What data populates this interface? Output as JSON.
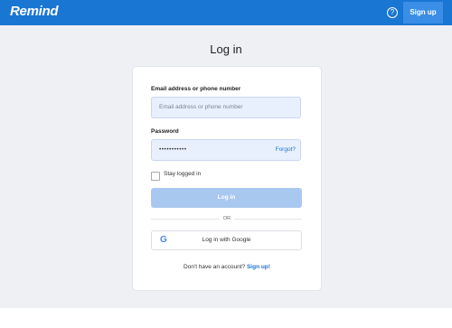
{
  "header": {
    "logo": "Remind",
    "help_icon": "help-circle-icon",
    "signup_label": "Sign up",
    "accent_color": "#1976d2"
  },
  "page": {
    "title": "Log in"
  },
  "form": {
    "email_label": "Email address or phone number",
    "email_placeholder": "Email address or phone number",
    "password_label": "Password",
    "password_value": "•••••••••••",
    "forgot_label": "Forgot?",
    "stay_logged_in_label": "Stay logged in",
    "stay_logged_in_checked": false,
    "login_button": "Log in",
    "divider_text": "OR",
    "google_button": "Log in with Google",
    "google_icon": "google-g-icon",
    "footer_prefix": "Don't have an account?",
    "footer_link": "Sign up!"
  }
}
